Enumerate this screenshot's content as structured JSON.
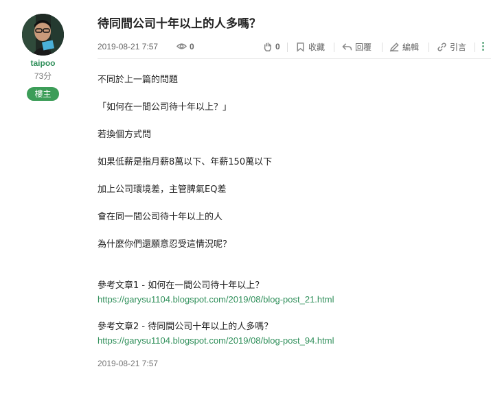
{
  "author": {
    "username": "taipoo",
    "points": "73分",
    "badge": "樓主"
  },
  "post": {
    "title": "待同間公司十年以上的人多嗎？",
    "date": "2019-08-21 7:57",
    "views": "0",
    "likes": "0",
    "actions": {
      "bookmark": "收藏",
      "reply": "回覆",
      "edit": "編輯",
      "quote": "引言"
    },
    "paragraphs": [
      "不同於上一篇的問題",
      "「如何在一間公司待十年以上？」",
      "若換個方式問",
      "如果低薪是指月薪8萬以下、年薪150萬以下",
      "加上公司環境差，主管脾氣EQ差",
      "會在同一間公司待十年以上的人",
      "為什麼你們還願意忍受這情況呢？"
    ],
    "references": [
      {
        "label": "參考文章1 - 如何在一間公司待十年以上？",
        "url": "https://garysu1104.blogspot.com/2019/08/blog-post_21.html"
      },
      {
        "label": "參考文章2 - 待同間公司十年以上的人多嗎？",
        "url": "https://garysu1104.blogspot.com/2019/08/blog-post_94.html"
      }
    ],
    "footer_date": "2019-08-21 7:57"
  },
  "colors": {
    "accent_green": "#2f8f5a",
    "badge_green": "#3c9d58"
  },
  "icons": [
    "eye-icon",
    "hand-like-icon",
    "bookmark-icon",
    "reply-icon",
    "edit-pencil-icon",
    "quote-link-icon",
    "more-dots-icon"
  ]
}
